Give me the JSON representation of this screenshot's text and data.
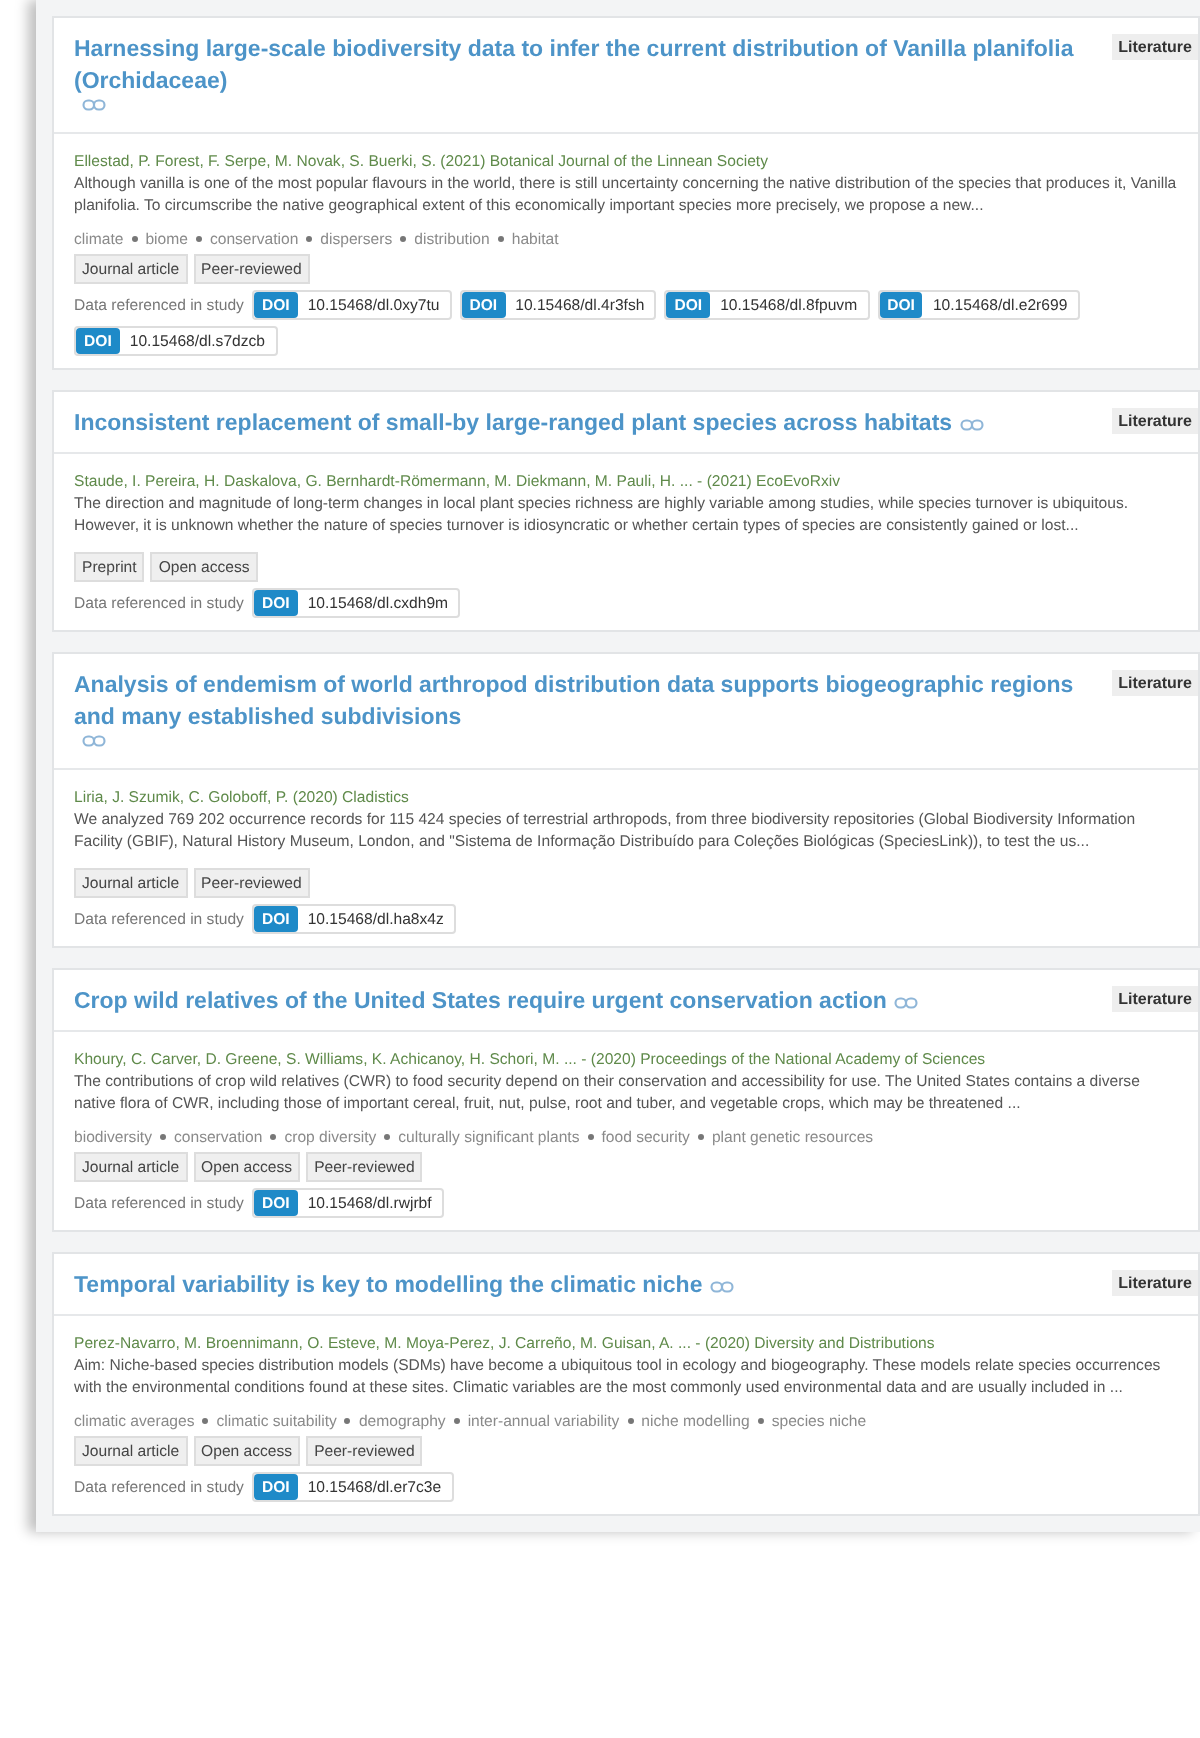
{
  "results": [
    {
      "title": "Harnessing large-scale biodiversity data to infer the current distribution of Vanilla planifolia (Orchidaceae)",
      "badge": "Literature",
      "authors": "Ellestad, P. Forest, F. Serpe, M. Novak, S. Buerki, S. (2021) Botanical Journal of the Linnean Society",
      "abstract": "Although vanilla is one of the most popular flavours in the world, there is still uncertainty concerning the native distribution of the species that produces it, Vanilla planifolia. To circumscribe the native geographical extent of this economically important species more precisely, we propose a new...",
      "keywords": [
        "climate",
        "biome",
        "conservation",
        "dispersers",
        "distribution",
        "habitat"
      ],
      "tags": [
        "Journal article",
        "Peer-reviewed"
      ],
      "data_label": "Data referenced in study",
      "dois": [
        {
          "label": "DOI",
          "id": "10.15468/dl.0xy7tu"
        },
        {
          "label": "DOI",
          "id": "10.15468/dl.4r3fsh"
        },
        {
          "label": "DOI",
          "id": "10.15468/dl.8fpuvm"
        },
        {
          "label": "DOI",
          "id": "10.15468/dl.e2r699"
        },
        {
          "label": "DOI",
          "id": "10.15468/dl.s7dzcb"
        }
      ]
    },
    {
      "title": "Inconsistent replacement of small-by large-ranged plant species across habitats",
      "badge": "Literature",
      "authors": "Staude, I. Pereira, H. Daskalova, G. Bernhardt-Römermann, M. Diekmann, M. Pauli, H. ... - (2021) EcoEvoRxiv",
      "abstract": "The direction and magnitude of long-term changes in local plant species richness are highly variable among studies, while species turnover is ubiquitous. However, it is unknown whether the nature of species turnover is idiosyncratic or whether certain types of species are consistently gained or lost...",
      "tags": [
        "Preprint",
        "Open access"
      ],
      "data_label": "Data referenced in study",
      "dois": [
        {
          "label": "DOI",
          "id": "10.15468/dl.cxdh9m"
        }
      ]
    },
    {
      "title": "Analysis of endemism of world arthropod distribution data supports biogeographic regions and many established subdivisions",
      "badge": "Literature",
      "authors": "Liria, J. Szumik, C. Goloboff, P. (2020) Cladistics",
      "abstract": "We analyzed 769 202 occurrence records for 115 424 species of terrestrial arthropods, from three biodiversity repositories (Global Biodiversity Information Facility (GBIF), Natural History Museum, London, and \"Sistema de Informação Distribuído para Coleções Biológicas (SpeciesLink)), to test the us...",
      "tags": [
        "Journal article",
        "Peer-reviewed"
      ],
      "data_label": "Data referenced in study",
      "dois": [
        {
          "label": "DOI",
          "id": "10.15468/dl.ha8x4z"
        }
      ]
    },
    {
      "title": "Crop wild relatives of the United States require urgent conservation action",
      "badge": "Literature",
      "authors": "Khoury, C. Carver, D. Greene, S. Williams, K. Achicanoy, H. Schori, M. ... - (2020) Proceedings of the National Academy of Sciences",
      "abstract": "The contributions of crop wild relatives (CWR) to food security depend on their conservation and accessibility for use. The United States contains a diverse native flora of CWR, including those of important cereal, fruit, nut, pulse, root and tuber, and vegetable crops, which may be threatened ...",
      "keywords": [
        "biodiversity",
        "conservation",
        "crop diversity",
        "culturally significant plants",
        "food security",
        "plant genetic resources"
      ],
      "tags": [
        "Journal article",
        "Open access",
        "Peer-reviewed"
      ],
      "data_label": "Data referenced in study",
      "dois": [
        {
          "label": "DOI",
          "id": "10.15468/dl.rwjrbf"
        }
      ]
    },
    {
      "title": "Temporal variability is key to modelling the climatic niche",
      "badge": "Literature",
      "authors": "Perez-Navarro, M. Broennimann, O. Esteve, M. Moya-Perez, J. Carreño, M. Guisan, A. ... - (2020) Diversity and Distributions",
      "abstract": "Aim: Niche-based species distribution models (SDMs) have become a ubiquitous tool in ecology and biogeography. These models relate species occurrences with the environmental conditions found at these sites. Climatic variables are the most commonly used environmental data and are usually included in ...",
      "keywords": [
        "climatic averages",
        "climatic suitability",
        "demography",
        "inter-annual variability",
        "niche modelling",
        "species niche"
      ],
      "tags": [
        "Journal article",
        "Open access",
        "Peer-reviewed"
      ],
      "data_label": "Data referenced in study",
      "dois": [
        {
          "label": "DOI",
          "id": "10.15468/dl.er7c3e"
        }
      ]
    }
  ]
}
